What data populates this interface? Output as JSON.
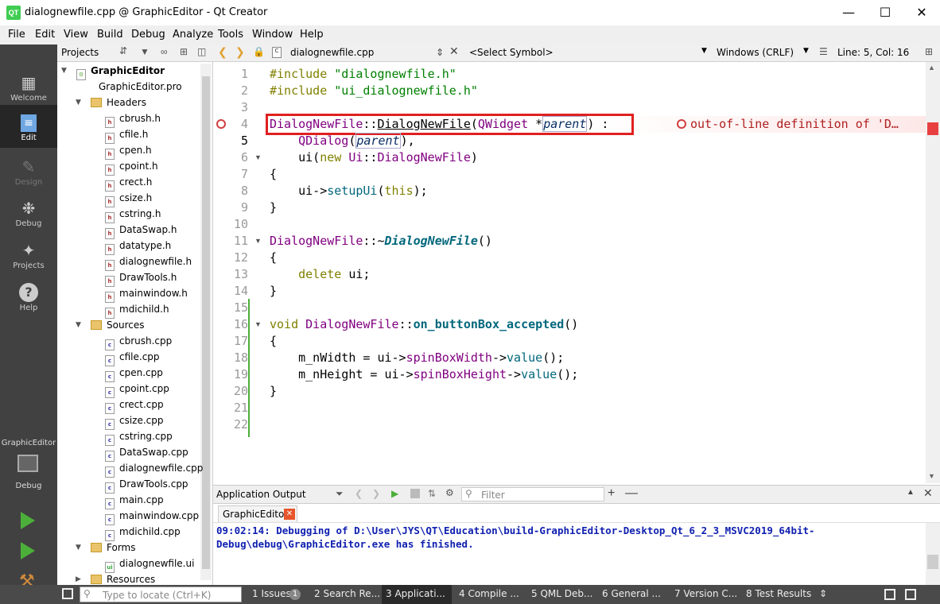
{
  "window": {
    "title": "dialognewfile.cpp @ GraphicEditor - Qt Creator",
    "icon_text": "QT"
  },
  "menu": [
    "File",
    "Edit",
    "View",
    "Build",
    "Debug",
    "Analyze",
    "Tools",
    "Window",
    "Help"
  ],
  "modes": [
    {
      "label": "Welcome",
      "icon": "grid-icon"
    },
    {
      "label": "Edit",
      "icon": "document-icon"
    },
    {
      "label": "Design",
      "icon": "pencil-icon"
    },
    {
      "label": "Debug",
      "icon": "bug-icon"
    },
    {
      "label": "Projects",
      "icon": "wrench-icon"
    },
    {
      "label": "Help",
      "icon": "question-icon"
    }
  ],
  "kit": {
    "project": "GraphicEditor",
    "config": "Debug"
  },
  "projects_panel": {
    "title": "Projects"
  },
  "tree": {
    "root": "GraphicEditor",
    "pro": "GraphicEditor.pro",
    "headers_label": "Headers",
    "headers": [
      "cbrush.h",
      "cfile.h",
      "cpen.h",
      "cpoint.h",
      "crect.h",
      "csize.h",
      "cstring.h",
      "DataSwap.h",
      "datatype.h",
      "dialognewfile.h",
      "DrawTools.h",
      "mainwindow.h",
      "mdichild.h"
    ],
    "sources_label": "Sources",
    "sources": [
      "cbrush.cpp",
      "cfile.cpp",
      "cpen.cpp",
      "cpoint.cpp",
      "crect.cpp",
      "csize.cpp",
      "cstring.cpp",
      "DataSwap.cpp",
      "dialognewfile.cpp",
      "DrawTools.cpp",
      "main.cpp",
      "mainwindow.cpp",
      "mdichild.cpp"
    ],
    "forms_label": "Forms",
    "forms": [
      "dialognewfile.ui"
    ],
    "resources_label": "Resources"
  },
  "editor": {
    "file_tab": "dialognewfile.cpp",
    "symbol": "<Select Symbol>",
    "line_ending": "Windows (CRLF)",
    "position": "Line: 5, Col: 16",
    "line_numbers": [
      "1",
      "2",
      "3",
      "4",
      "5",
      "6",
      "7",
      "8",
      "9",
      "10",
      "11",
      "12",
      "13",
      "14",
      "15",
      "16",
      "17",
      "18",
      "19",
      "20",
      "21",
      "22"
    ],
    "diagnostic": "out-of-line definition of 'D…"
  },
  "output": {
    "title": "Application Output",
    "filter_placeholder": "Filter",
    "tab": "GraphicEditor",
    "line1": "09:02:14: Debugging of D:\\User\\JYS\\QT\\Education\\build-GraphicEditor-Desktop_Qt_6_2_3_MSVC2019_64bit-",
    "line2": "Debug\\debug\\GraphicEditor.exe has finished."
  },
  "statusbar": {
    "locator_placeholder": "Type to locate (Ctrl+K)",
    "issues_count": "1",
    "panes": [
      "1 Issues",
      "2 Search Re...",
      "3 Applicati...",
      "4 Compile ...",
      "5 QML Deb...",
      "6 General ...",
      "7 Version C...",
      "8 Test Results"
    ]
  }
}
